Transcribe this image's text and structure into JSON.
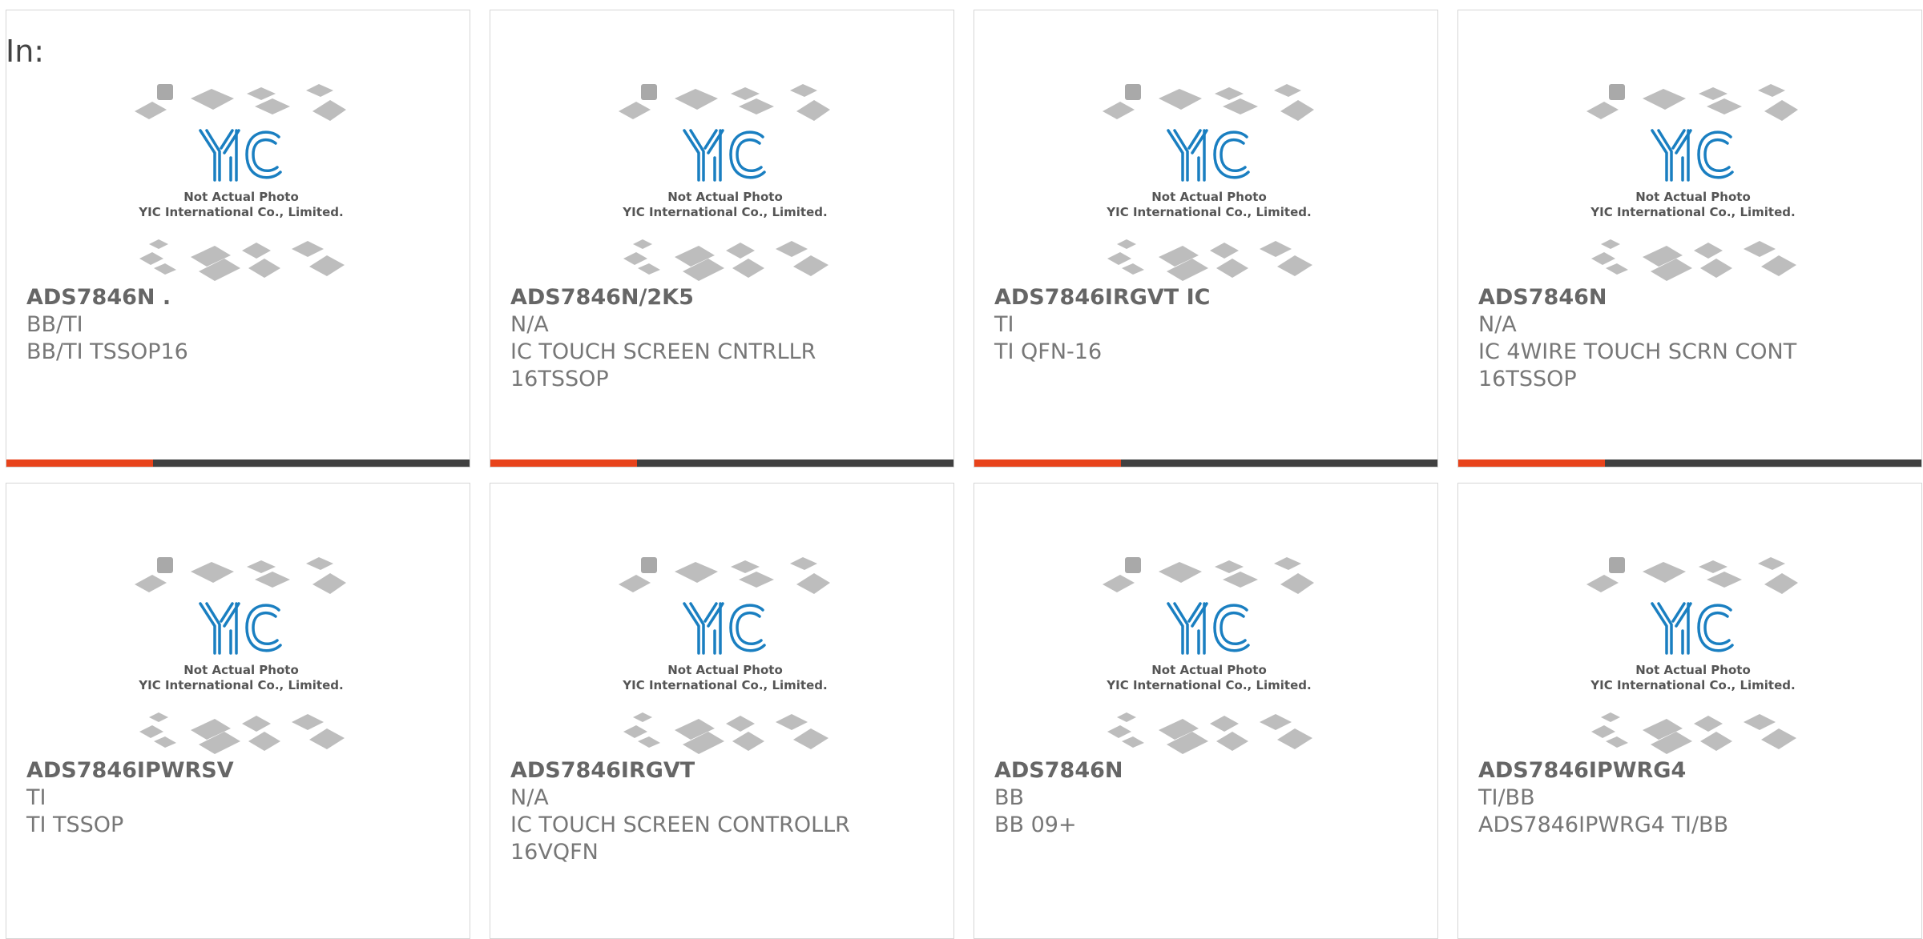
{
  "page": {
    "label": "In:"
  },
  "photo": {
    "caption_line1": "Not Actual Photo",
    "caption_line2": "YIC International Co., Limited.",
    "logo": "YIC"
  },
  "colors": {
    "accent": "#e8431b",
    "bar": "#404040",
    "logo_blue": "#1a7fc1"
  },
  "products": [
    {
      "part_number": "ADS7846N .",
      "manufacturer": "BB/TI",
      "description": "BB/TI TSSOP16"
    },
    {
      "part_number": "ADS7846N/2K5",
      "manufacturer": "N/A",
      "description": "IC TOUCH SCREEN CNTRLLR\n16TSSOP"
    },
    {
      "part_number": "ADS7846IRGVT IC",
      "manufacturer": "TI",
      "description": "TI QFN-16"
    },
    {
      "part_number": "ADS7846N",
      "manufacturer": "N/A",
      "description": "IC 4WIRE TOUCH SCRN CONT\n16TSSOP"
    },
    {
      "part_number": "ADS7846IPWRSV",
      "manufacturer": "TI",
      "description": "TI TSSOP"
    },
    {
      "part_number": "ADS7846IRGVT",
      "manufacturer": "N/A",
      "description": "IC TOUCH SCREEN CONTROLLR\n16VQFN"
    },
    {
      "part_number": "ADS7846N",
      "manufacturer": "BB",
      "description": "BB 09+"
    },
    {
      "part_number": "ADS7846IPWRG4",
      "manufacturer": "TI/BB",
      "description": "ADS7846IPWRG4 TI/BB"
    }
  ]
}
